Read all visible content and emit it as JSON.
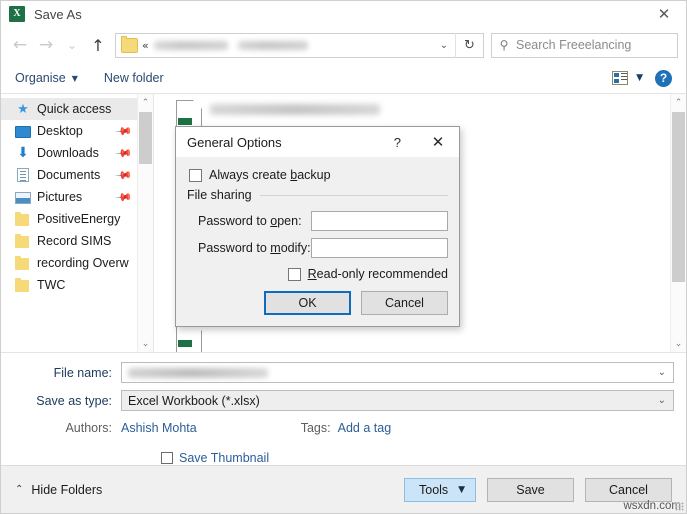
{
  "window": {
    "title": "Save As",
    "app_icon": "excel-icon",
    "close_label": "✕"
  },
  "nav": {
    "back_icon": "←",
    "forward_icon": "→",
    "recent_icon": "⌄",
    "up_icon": "↑",
    "address": {
      "folder_icon": "folder-icon",
      "overflow_label": "«",
      "breadcrumbs_blurred": true,
      "dropdown_icon": "⌄",
      "refresh_icon": "↻"
    },
    "search": {
      "icon": "search-icon",
      "placeholder": "Search Freeelancing",
      "value": ""
    }
  },
  "commandbar": {
    "organise_label": "Organise",
    "organise_caret": "▼",
    "new_folder_label": "New folder",
    "view_caret": "▼",
    "help_label": "?"
  },
  "sidebar": {
    "items": [
      {
        "label": "Quick access",
        "icon": "star-icon",
        "selected": true,
        "pinned": false
      },
      {
        "label": "Desktop",
        "icon": "desktop-icon",
        "selected": false,
        "pinned": true
      },
      {
        "label": "Downloads",
        "icon": "download-icon",
        "selected": false,
        "pinned": true
      },
      {
        "label": "Documents",
        "icon": "document-icon",
        "selected": false,
        "pinned": true
      },
      {
        "label": "Pictures",
        "icon": "pictures-icon",
        "selected": false,
        "pinned": true
      },
      {
        "label": "PositiveEnergy",
        "icon": "folder-icon",
        "selected": false,
        "pinned": false
      },
      {
        "label": "Record SIMS",
        "icon": "folder-icon",
        "selected": false,
        "pinned": false
      },
      {
        "label": "recording Overw",
        "icon": "folder-icon",
        "selected": false,
        "pinned": false
      },
      {
        "label": "TWC",
        "icon": "folder-icon",
        "selected": false,
        "pinned": false
      }
    ],
    "scroll_up_icon": "⌃",
    "scroll_down_icon": "⌄"
  },
  "filepane": {
    "scroll_up_icon": "⌃",
    "scroll_down_icon": "⌄",
    "files": [
      {
        "icon": "excel-file-icon",
        "name_blurred": true
      },
      {
        "icon": "excel-file-icon",
        "name_blurred": true
      },
      {
        "icon": "excel-file-icon",
        "name_blurred": true
      }
    ]
  },
  "form": {
    "file_name_label": "File name:",
    "file_name_value_blurred": true,
    "file_name_caret": "⌄",
    "save_as_type_label": "Save as type:",
    "save_as_type_value": "Excel Workbook (*.xlsx)",
    "save_as_type_caret": "⌄",
    "authors_label": "Authors:",
    "authors_value": "Ashish Mohta",
    "tags_label": "Tags:",
    "tags_value": "Add a tag",
    "save_thumbnail_label": "Save Thumbnail",
    "save_thumbnail_checked": false
  },
  "footer": {
    "hide_folders_label": "Hide Folders",
    "hide_folders_caret": "⌃",
    "tools_label": "Tools",
    "tools_caret": "▼",
    "save_label": "Save",
    "cancel_label": "Cancel",
    "watermark": "wsxdn.com"
  },
  "dialog": {
    "title": "General Options",
    "help_label": "?",
    "close_label": "✕",
    "always_create_backup": {
      "label_pre": "Always create ",
      "label_accel": "b",
      "label_post": "ackup",
      "checked": false
    },
    "file_sharing_label": "File sharing",
    "password_to_open": {
      "label_pre": "Password to ",
      "label_accel": "o",
      "label_post": "pen:",
      "value": ""
    },
    "password_to_modify": {
      "label_pre": "Password to ",
      "label_accel": "m",
      "label_post": "odify:",
      "value": ""
    },
    "read_only_recommended": {
      "label_pre": "",
      "label_accel": "R",
      "label_post": "ead-only recommended",
      "checked": false
    },
    "ok_label": "OK",
    "cancel_label": "Cancel"
  },
  "colors": {
    "accent_blue": "#0f6cbd",
    "tools_highlight": "#cce4f7",
    "link_blue": "#2b5d9b",
    "excel_green": "#1e7145",
    "selected_row": "#eaeaea"
  }
}
